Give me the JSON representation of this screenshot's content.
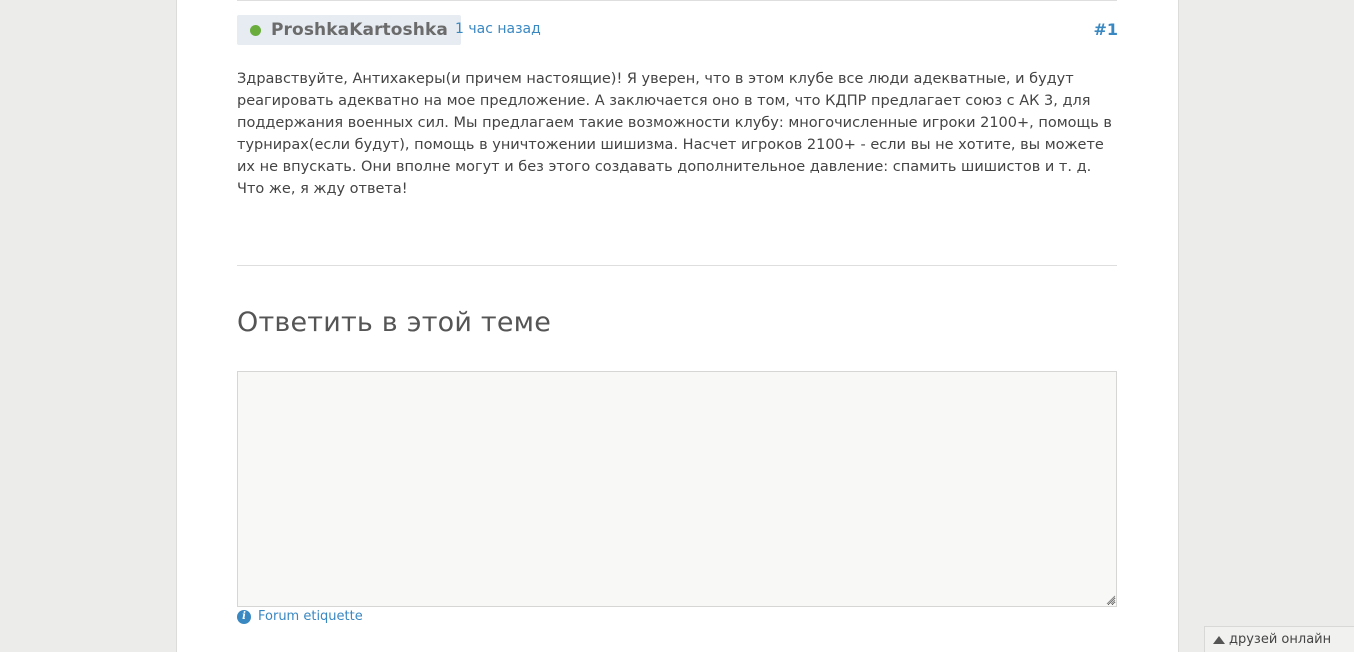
{
  "post": {
    "author": "ProshkaKartoshka",
    "author_online": true,
    "time": "1 час назад",
    "number": "#1",
    "body": "Здравствуйте, Антихакеры(и причем настоящие)! Я уверен, что в этом клубе все люди адекватные, и будут реагировать адекватно на мое предложение. А заключается оно в том, что КДПР предлагает союз с АК 3, для поддержания военных сил. Мы предлагаем такие возможности клубу: многочисленные игроки 2100+, помощь в турнирах(если будут), помощь в уничтожении шишизма. Насчет игроков 2100+ - если вы не хотите, вы можете их не впускать. Они вполне могут и без этого создавать дополнительное давление: спамить шишистов и т. д. Что же, я жду ответа!"
  },
  "reply": {
    "heading": "Ответить в этой теме",
    "textarea_value": ""
  },
  "etiquette": {
    "link_label": "Forum etiquette",
    "icon": "info-icon"
  },
  "friends_bar": {
    "label": "друзей онлайн",
    "icon": "triangle-up-icon"
  },
  "colors": {
    "link": "#3a88c2",
    "online": "#6aad3d",
    "author_chip_bg": "#e6ecf2",
    "page_bg": "#ececea"
  }
}
